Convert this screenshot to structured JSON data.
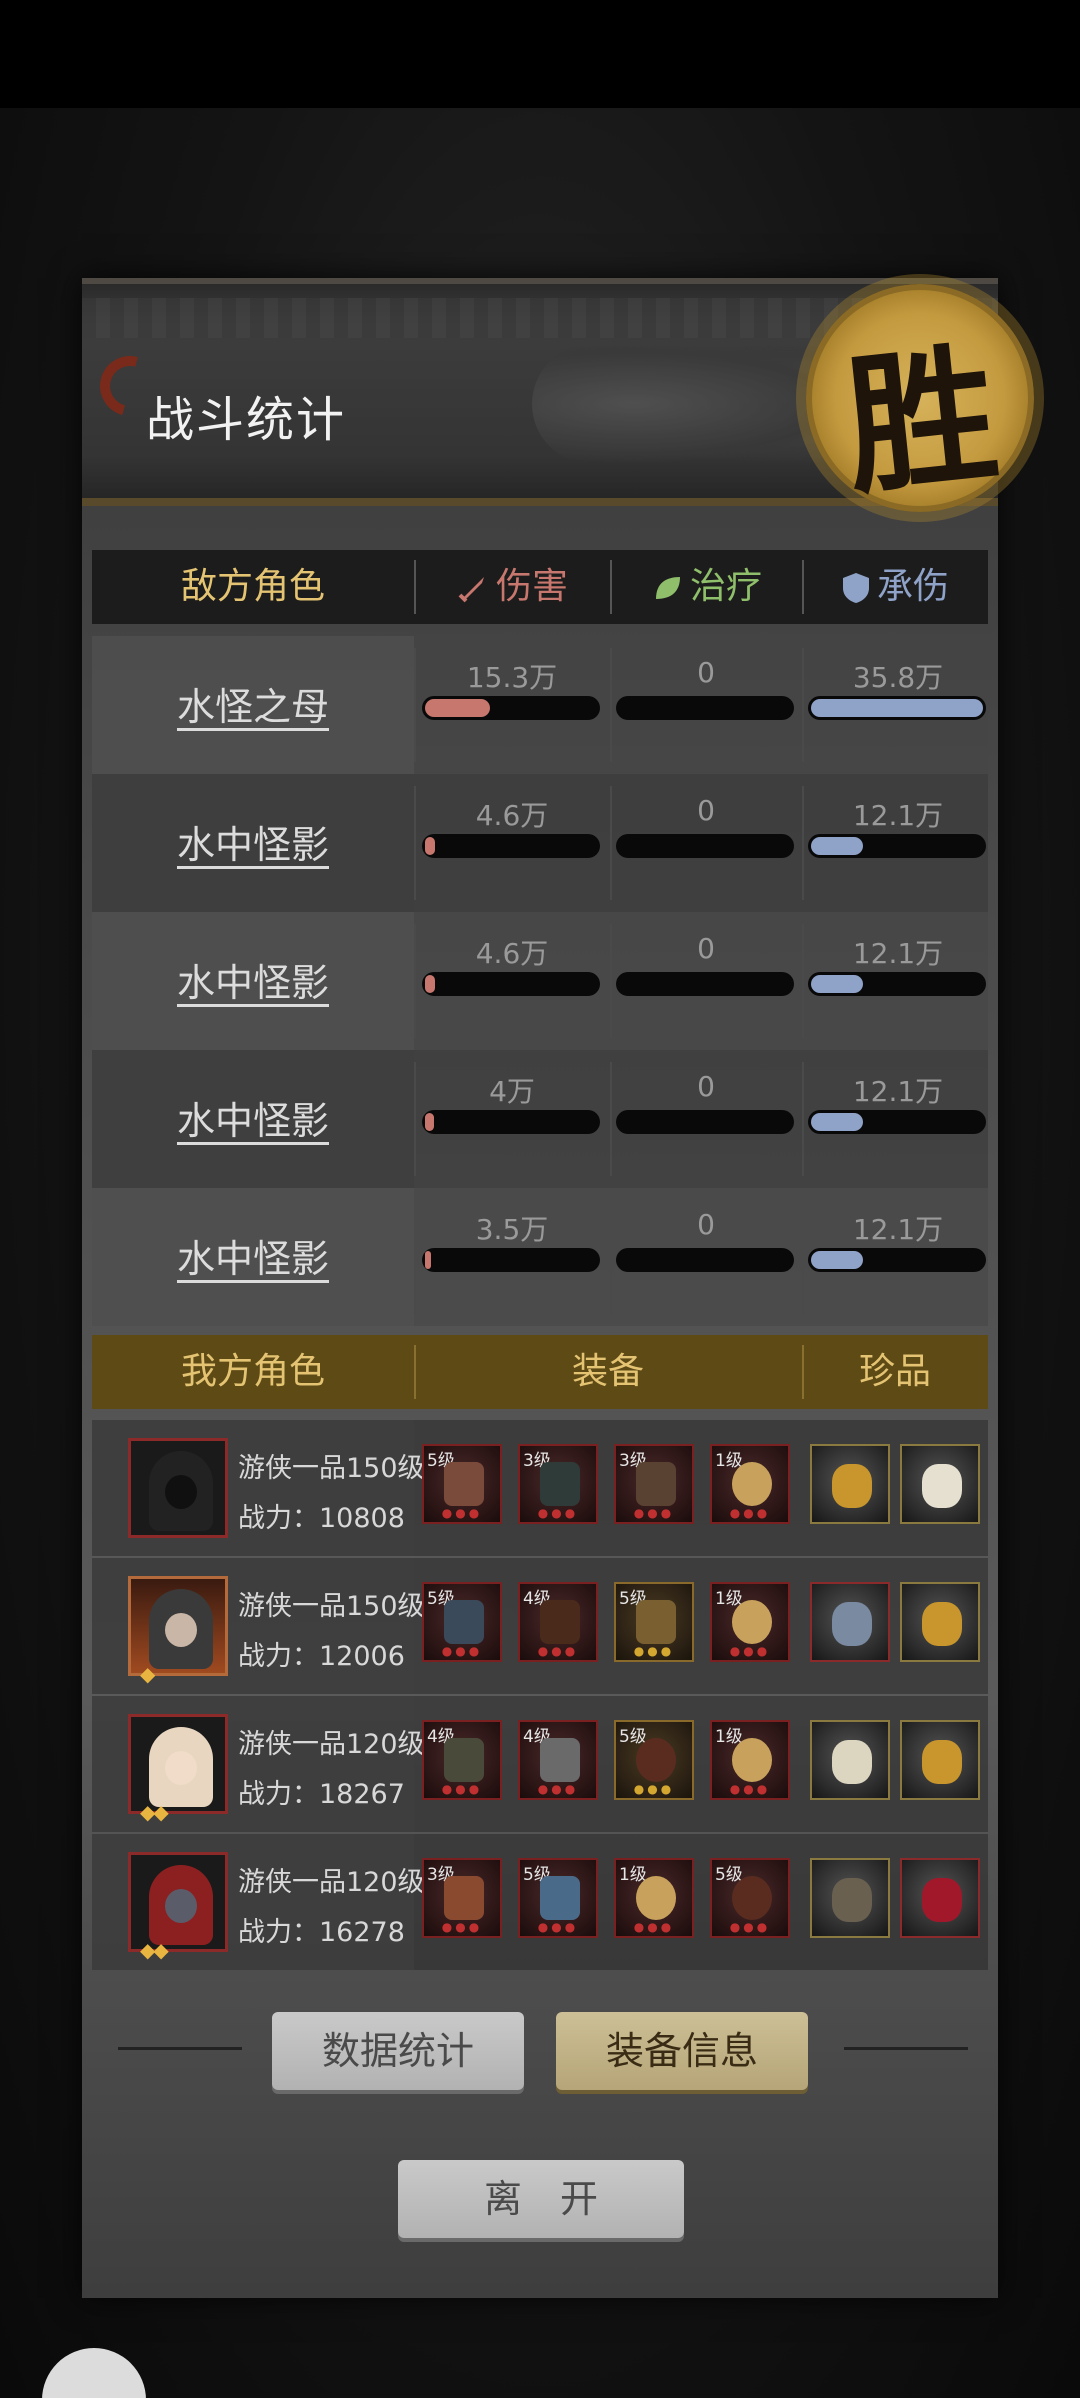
{
  "title": "战斗统计",
  "victory_char": "胜",
  "enemy_table": {
    "headers": {
      "role": "敌方角色",
      "damage": "伤害",
      "heal": "治疗",
      "taken": "承伤"
    },
    "damage_icon": "sword-icon",
    "heal_icon": "leaf-icon",
    "taken_icon": "shield-icon",
    "rows": [
      {
        "name": "水怪之母",
        "damage": "15.3万",
        "heal": "0",
        "taken": "35.8万",
        "damage_fill": 0.38,
        "heal_fill": 0,
        "taken_fill": 1.0
      },
      {
        "name": "水中怪影",
        "damage": "4.6万",
        "heal": "0",
        "taken": "12.1万",
        "damage_fill": 0.06,
        "heal_fill": 0,
        "taken_fill": 0.3
      },
      {
        "name": "水中怪影",
        "damage": "4.6万",
        "heal": "0",
        "taken": "12.1万",
        "damage_fill": 0.06,
        "heal_fill": 0,
        "taken_fill": 0.3
      },
      {
        "name": "水中怪影",
        "damage": "4万",
        "heal": "0",
        "taken": "12.1万",
        "damage_fill": 0.05,
        "heal_fill": 0,
        "taken_fill": 0.3
      },
      {
        "name": "水中怪影",
        "damage": "3.5万",
        "heal": "0",
        "taken": "12.1万",
        "damage_fill": 0.03,
        "heal_fill": 0,
        "taken_fill": 0.3
      }
    ]
  },
  "ally_table": {
    "headers": {
      "role": "我方角色",
      "equipment": "装备",
      "treasure": "珍品"
    },
    "rows": [
      {
        "rank": "游侠一品150级",
        "power": "战力：10808",
        "stars": "",
        "equipment": [
          {
            "level": "5级",
            "icon": "dagger-icon"
          },
          {
            "level": "3级",
            "icon": "cloak-icon"
          },
          {
            "level": "3级",
            "icon": "lantern-icon"
          },
          {
            "level": "1级",
            "icon": "gourd-icon"
          }
        ],
        "treasures": [
          {
            "icon": "golden-hairpin-icon"
          },
          {
            "icon": "jade-snake-icon"
          }
        ]
      },
      {
        "rank": "游侠一品150级",
        "power": "战力：12006",
        "stars": "◆",
        "equipment": [
          {
            "level": "5级",
            "icon": "sword-icon"
          },
          {
            "level": "4级",
            "icon": "robe-icon"
          },
          {
            "level": "5级",
            "icon": "bell-icon"
          },
          {
            "level": "1级",
            "icon": "gourd-icon"
          }
        ],
        "treasures": [
          {
            "icon": "jade-beast-icon"
          },
          {
            "icon": "golden-hairpin-icon"
          }
        ]
      },
      {
        "rank": "游侠一品120级",
        "power": "战力：18267",
        "stars": "◆◆",
        "equipment": [
          {
            "level": "4级",
            "icon": "crossbow-icon"
          },
          {
            "level": "4级",
            "icon": "armor-icon"
          },
          {
            "level": "5级",
            "icon": "prayer-beads-icon"
          },
          {
            "level": "1级",
            "icon": "gourd-icon"
          }
        ],
        "treasures": [
          {
            "icon": "jade-rabbit-icon"
          },
          {
            "icon": "golden-hairpin-icon"
          }
        ]
      },
      {
        "rank": "游侠一品120级",
        "power": "战力：16278",
        "stars": "◆◆",
        "equipment": [
          {
            "level": "3级",
            "icon": "mace-icon"
          },
          {
            "level": "5级",
            "icon": "vest-icon"
          },
          {
            "level": "1级",
            "icon": "gourd-icon"
          },
          {
            "level": "5级",
            "icon": "prayer-beads-icon"
          }
        ],
        "treasures": [
          {
            "icon": "stone-slab-icon"
          },
          {
            "icon": "red-gem-icon"
          }
        ]
      }
    ]
  },
  "buttons": {
    "stats": "数据统计",
    "equip_info": "装备信息",
    "leave": "离　开"
  },
  "colors": {
    "damage": "#c7776e",
    "heal": "#8fbf6a",
    "taken": "#8fa2c8",
    "header_gold": "#e4c372",
    "ally_header_bg": "#5e4a15"
  }
}
